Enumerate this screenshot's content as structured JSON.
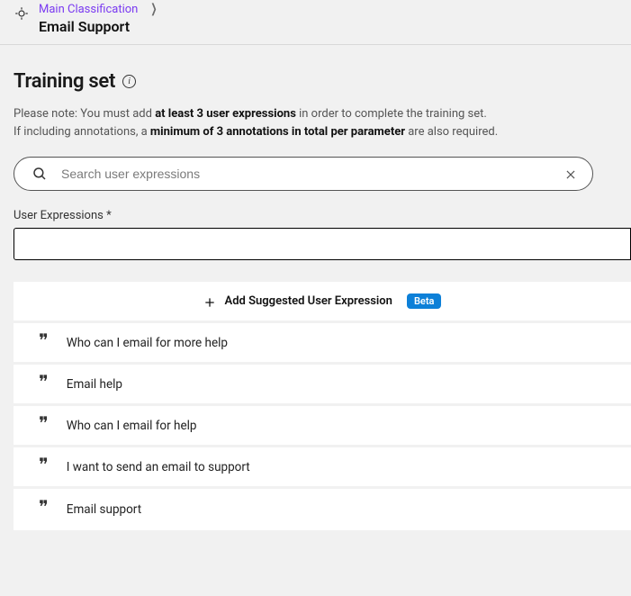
{
  "breadcrumb": {
    "parent": "Main Classification",
    "current": "Email Support"
  },
  "section": {
    "title": "Training set",
    "note_prefix": "Please note: You must add ",
    "note_bold1": "at least 3 user expressions",
    "note_mid": " in order to complete the training set.",
    "note_line2_prefix": "If including annotations, a ",
    "note_bold2": "minimum of 3 annotations in total per parameter",
    "note_line2_suffix": " are also required."
  },
  "search": {
    "placeholder": "Search user expressions"
  },
  "field": {
    "label": "User Expressions *",
    "value": ""
  },
  "add": {
    "label": "Add Suggested User Expression",
    "badge": "Beta"
  },
  "expressions": [
    {
      "text": "Who can I email for more help"
    },
    {
      "text": "Email help"
    },
    {
      "text": "Who can I email for help"
    },
    {
      "text": "I want to send an email to support"
    },
    {
      "text": "Email support"
    }
  ]
}
